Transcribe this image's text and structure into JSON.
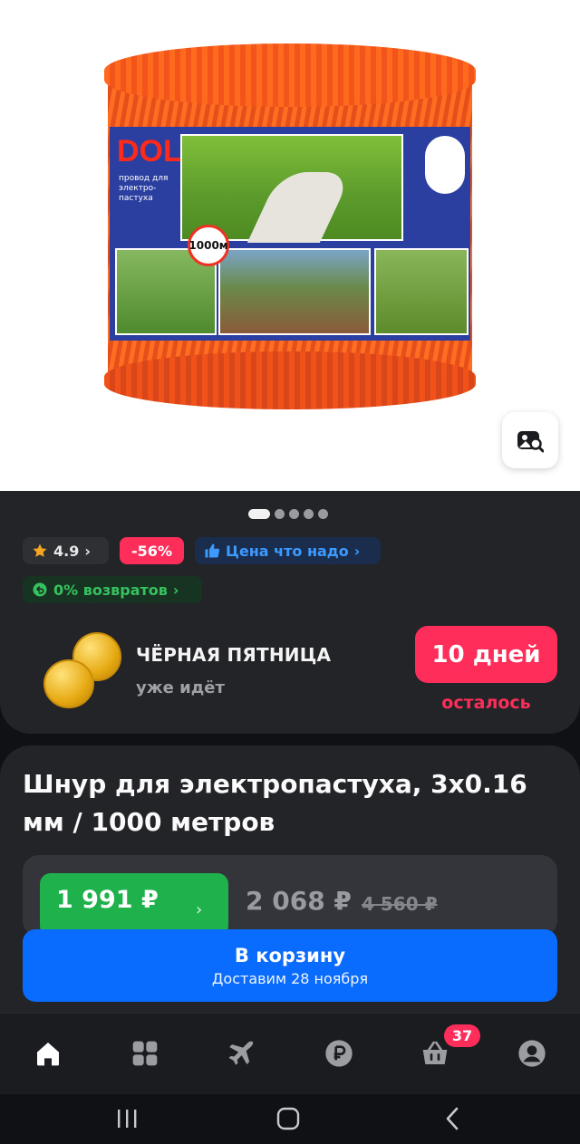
{
  "product_image": {
    "brand_text": "DOLLY",
    "label_text": "провод для электро-пастуха",
    "length_badge": "1000м"
  },
  "carousel": {
    "count": 5,
    "active": 0
  },
  "chips": {
    "rating": "4.9",
    "discount": "-56%",
    "price_promo": "Цена что надо",
    "returns": "0% возвратов"
  },
  "promo": {
    "title": "ЧЁРНАЯ ПЯТНИЦА",
    "subtitle": "уже идёт",
    "days": "10 дней",
    "days_caption": "осталось"
  },
  "product": {
    "title": "Шнур для электропастуха, 3х0.16 мм / 1000 метров",
    "price_card": "1 991 ₽",
    "price_regular": "2 068 ₽",
    "price_old": "4 560 ₽"
  },
  "cart_button": {
    "label": "В корзину",
    "delivery": "Доставим 28 ноября"
  },
  "bottom_nav": {
    "items": [
      "home-icon",
      "catalog-icon",
      "travel-icon",
      "finance-icon",
      "cart-icon",
      "profile-icon"
    ],
    "cart_count": "37"
  },
  "colors": {
    "accent_blue": "#0a6cff",
    "sale_pink": "#ff2d5a",
    "price_green": "#1fb14b",
    "card_bg": "#232428"
  }
}
